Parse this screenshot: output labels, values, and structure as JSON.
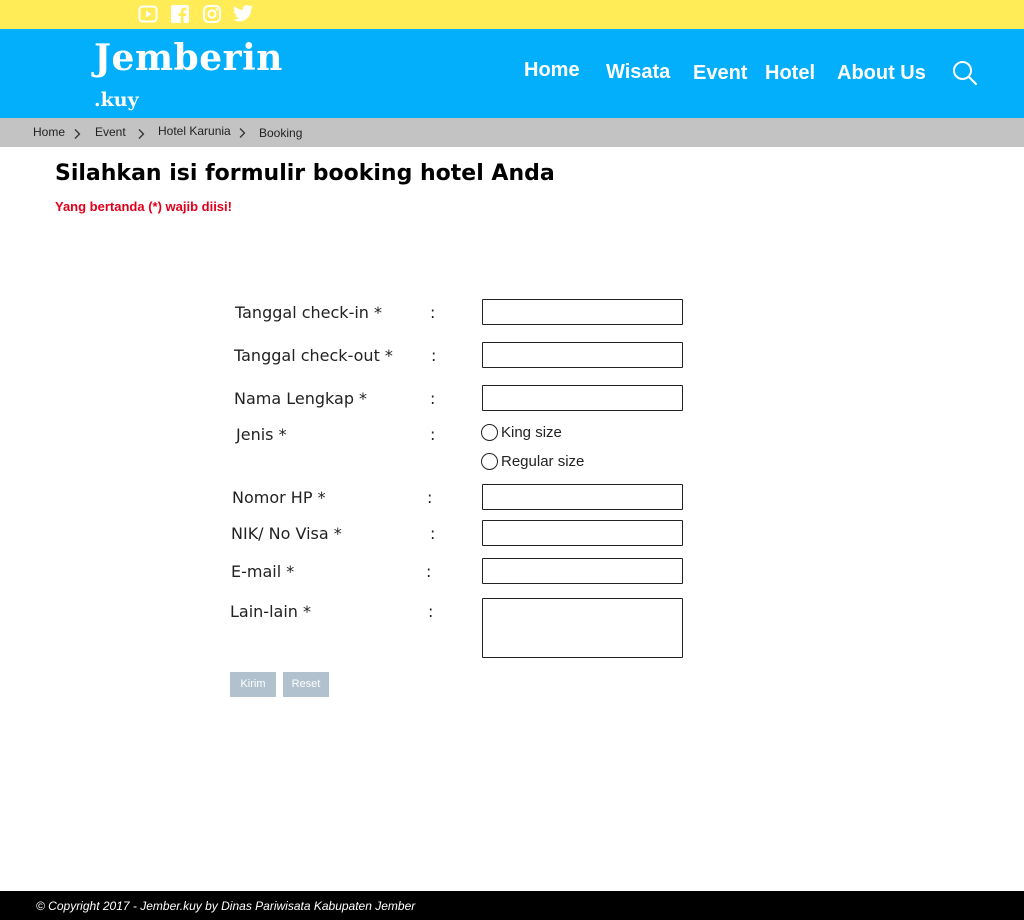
{
  "social": {
    "icons": [
      "youtube-icon",
      "facebook-icon",
      "instagram-icon",
      "twitter-icon"
    ]
  },
  "header": {
    "logo_main": "Jemberin",
    "logo_sub": ".kuy",
    "nav": [
      "Home",
      "Wisata",
      "Event",
      "Hotel",
      "About Us"
    ],
    "search_icon": "search-icon"
  },
  "breadcrumb": [
    "Home",
    "Event",
    "Hotel Karunia",
    "Booking"
  ],
  "page": {
    "title": "Silahkan isi formulir booking hotel Anda",
    "required_note": "Yang bertanda (*) wajib diisi!"
  },
  "form": {
    "colon": ":",
    "checkin_label": "Tanggal check-in *",
    "checkout_label": "Tanggal check-out *",
    "name_label": "Nama Lengkap *",
    "type_label": "Jenis *",
    "type_options": [
      "King size",
      "Regular size"
    ],
    "phone_label": "Nomor HP *",
    "nik_label": "NIK/ No Visa *",
    "email_label": "E-mail *",
    "other_label": "Lain-lain *",
    "submit_label": "Kirim",
    "reset_label": "Reset"
  },
  "footer": {
    "copyright": "© Copyright 2017 - Jember.kuy by Dinas Pariwisata Kabupaten Jember"
  },
  "colors": {
    "topbar": "#ffec57",
    "header": "#03aefb",
    "breadcrumb": "#c3c3c3",
    "required": "#e0001a",
    "button": "#b1c2ce",
    "footer": "#000000"
  }
}
